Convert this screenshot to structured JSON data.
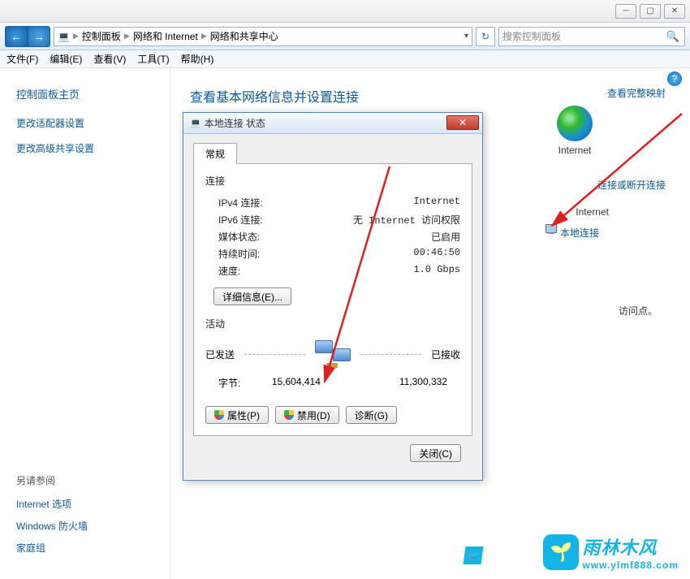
{
  "window": {
    "min": "─",
    "max": "▢",
    "close": "✕"
  },
  "nav": {
    "crumb_root_icon": "💻",
    "crumb1": "控制面板",
    "crumb2": "网络和 Internet",
    "crumb3": "网络和共享中心",
    "refresh_icon": "↻",
    "search_placeholder": "搜索控制面板",
    "search_icon": "🔍"
  },
  "menu": {
    "file": "文件(F)",
    "edit": "编辑(E)",
    "view": "查看(V)",
    "tools": "工具(T)",
    "help": "帮助(H)"
  },
  "sidebar": {
    "home": "控制面板主页",
    "link1": "更改适配器设置",
    "link2": "更改高级共享设置",
    "see_also_title": "另请参阅",
    "see_also_1": "Internet 选项",
    "see_also_2": "Windows 防火墙",
    "see_also_3": "家庭组"
  },
  "content": {
    "title": "查看基本网络信息并设置连接",
    "full_map": "查看完整映射",
    "internet_label": "Internet",
    "connect_disconnect": "连接或断开连接",
    "internet_text": "Internet",
    "local_conn": "本地连接",
    "footnote": "访问点。",
    "help_icon": "?"
  },
  "dialog": {
    "title": "本地连接 状态",
    "title_icon": "💻",
    "close": "✕",
    "tab_general": "常规",
    "section_connection": "连接",
    "rows": {
      "ipv4_label": "IPv4 连接:",
      "ipv4_value": "Internet",
      "ipv6_label": "IPv6 连接:",
      "ipv6_value": "无 Internet 访问权限",
      "media_label": "媒体状态:",
      "media_value": "已启用",
      "duration_label": "持续时间:",
      "duration_value": "00:46:50",
      "speed_label": "速度:",
      "speed_value": "1.0 Gbps"
    },
    "details_btn": "详细信息(E)...",
    "section_activity": "活动",
    "sent_label": "已发送",
    "recv_label": "已接收",
    "bytes_label": "字节:",
    "bytes_sent": "15,604,414",
    "bytes_recv": "11,300,332",
    "btn_properties": "属性(P)",
    "btn_disable": "禁用(D)",
    "btn_diagnose": "诊断(G)",
    "btn_close": "关闭(C)"
  },
  "watermark": {
    "brand": "雨林木风",
    "url": "www.ylmf888.com",
    "bird": "🐦"
  }
}
